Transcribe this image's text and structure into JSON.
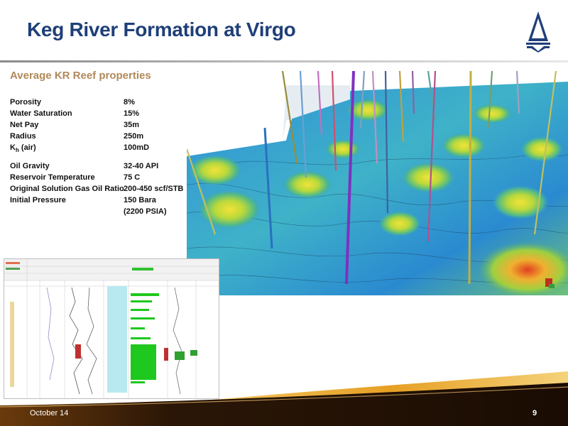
{
  "slide": {
    "title": "Keg River Formation at Virgo",
    "subtitle": "Average KR Reef properties",
    "footer_date": "October 14",
    "page_number": "9"
  },
  "properties": {
    "porosity": {
      "label": "Porosity",
      "value": "8%"
    },
    "water_saturation": {
      "label": "Water Saturation",
      "value": "15%"
    },
    "net_pay": {
      "label": "Net Pay",
      "value": "35m"
    },
    "radius": {
      "label": "Radius",
      "value": "250m"
    },
    "kh": {
      "label_main": "K",
      "label_sub": "h",
      "label_rest": " (air)",
      "value": "100mD"
    },
    "oil_gravity": {
      "label": "Oil Gravity",
      "value": "32-40 API"
    },
    "reservoir_temperature": {
      "label": "Reservoir Temperature",
      "value": "75 C"
    },
    "solution_gor": {
      "label": "Original Solution Gas Oil Ratio",
      "value": "200-450 scf/STB"
    },
    "initial_pressure": {
      "label": "Initial Pressure",
      "value": "150 Bara",
      "value2": "(2200 PSIA)"
    }
  },
  "colors": {
    "title": "#1f3f78",
    "subtitle": "#b0895a",
    "swoosh_gold": "#e0a020",
    "swoosh_dark": "#2a1606"
  },
  "icons": {
    "logo": "derrick-logo-icon"
  }
}
